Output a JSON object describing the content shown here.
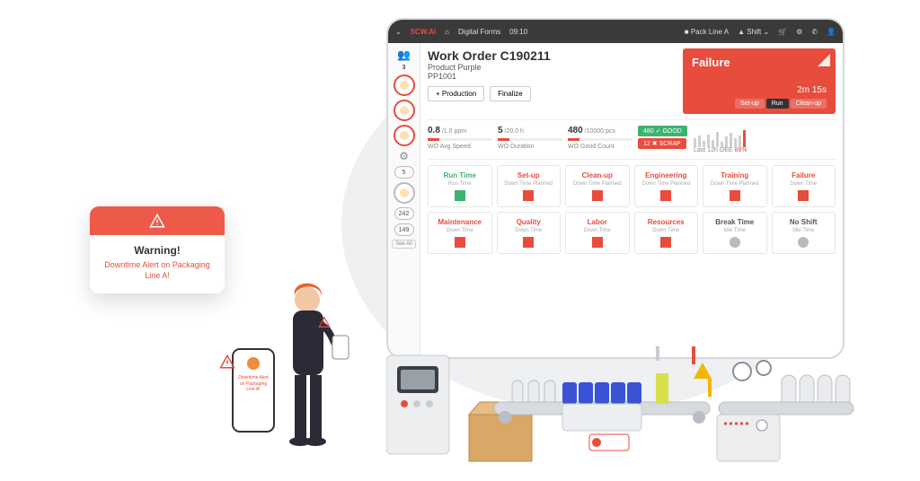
{
  "brand": "SCW.AI",
  "topbar": {
    "breadcrumb": "Digital Forms",
    "time": "09:10",
    "line": "Pack Line A",
    "shift": "Shift"
  },
  "sidebar": {
    "user_count": "3",
    "badge1": "5",
    "badge2": "242",
    "badge3": "149",
    "see_all": "See All"
  },
  "work_order": {
    "title": "Work Order C190211",
    "product": "Product Purple",
    "code": "PP1001",
    "btn_production": "+ Production",
    "btn_finalize": "Finalize"
  },
  "failure": {
    "title": "Failure",
    "elapsed": "2m 15s",
    "tab_setup": "Set-up",
    "tab_run": "Run",
    "tab_cleanup": "Clean-up"
  },
  "kpi": {
    "speed_val": "0.8",
    "speed_max": "/1.0 ppm",
    "speed_lbl": "WO Avg Speed",
    "dur_val": "5",
    "dur_max": "/20.0 h",
    "dur_lbl": "WO Duration",
    "count_val": "480",
    "count_max": "/10000 pcs",
    "count_lbl": "WO Good Count",
    "good_n": "480",
    "good_lbl": "GOOD",
    "scrap_n": "12",
    "scrap_lbl": "SCRAP",
    "spark_lbl": "Last 12h OEE",
    "spark_val": "88%"
  },
  "cards": [
    {
      "name": "Run Time",
      "sub": "Run Time",
      "cls": "green"
    },
    {
      "name": "Set-up",
      "sub": "Down Time Planned",
      "cls": "red"
    },
    {
      "name": "Clean-up",
      "sub": "Down Time Planned",
      "cls": "red"
    },
    {
      "name": "Engineering",
      "sub": "Down Time Planned",
      "cls": "red"
    },
    {
      "name": "Training",
      "sub": "Down Time Planned",
      "cls": "red"
    },
    {
      "name": "Failure",
      "sub": "Down Time",
      "cls": "red"
    },
    {
      "name": "Maintenance",
      "sub": "Down Time",
      "cls": "red"
    },
    {
      "name": "Quality",
      "sub": "Down Time",
      "cls": "red"
    },
    {
      "name": "Labor",
      "sub": "Down Time",
      "cls": "red"
    },
    {
      "name": "Resources",
      "sub": "Down Time",
      "cls": "red"
    },
    {
      "name": "Break Time",
      "sub": "Idle Time",
      "cls": "grey"
    },
    {
      "name": "No Shift",
      "sub": "Idle Time",
      "cls": "grey"
    }
  ],
  "warning": {
    "title": "Warning!",
    "msg": "Downtime Alert on Packaging  Line A!"
  },
  "phone": {
    "msg": "Downtime Alert on Packaging Line A!"
  }
}
